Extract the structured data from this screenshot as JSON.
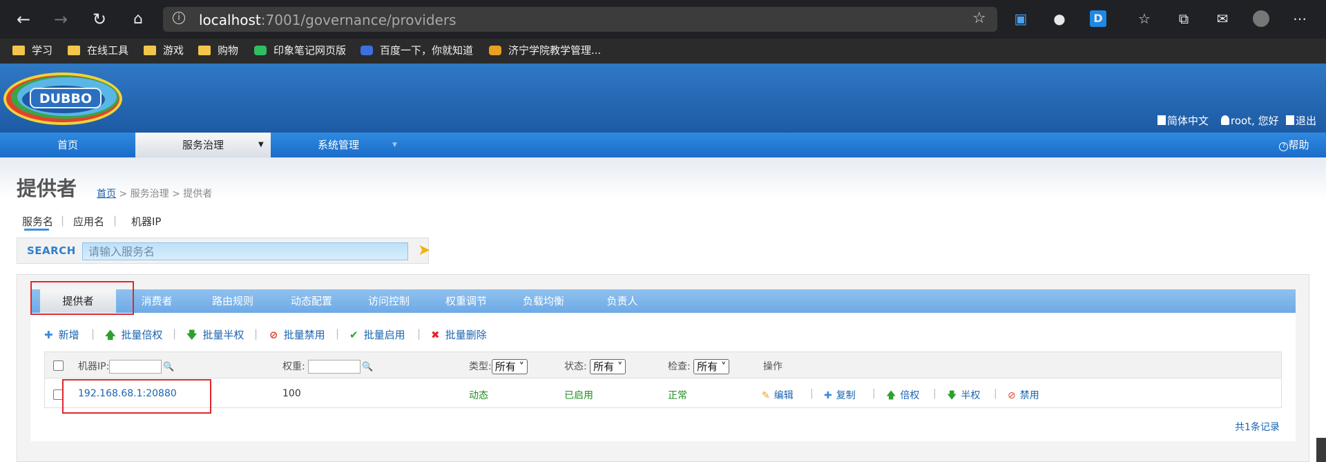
{
  "browser": {
    "url_host": "localhost",
    "url_path": ":7001/governance/providers",
    "bookmarks": [
      "学习",
      "在线工具",
      "游戏",
      "购物",
      "印象笔记网页版",
      "百度一下，你就知道",
      "济宁学院教学管理..."
    ]
  },
  "header": {
    "logo_text": "DUBBO",
    "language": "简体中文",
    "user_greeting": "root, 您好",
    "logout": "退出",
    "help": "帮助"
  },
  "nav": {
    "home": "首页",
    "governance": "服务治理",
    "system": "系统管理"
  },
  "page": {
    "title": "提供者",
    "breadcrumb_home": "首页",
    "breadcrumb_rest": " > 服务治理 > 提供者",
    "filter_tabs": [
      "服务名",
      "应用名",
      "机器IP"
    ]
  },
  "search": {
    "label": "SEARCH",
    "placeholder": "请输入服务名"
  },
  "tabs": [
    "提供者",
    "消费者",
    "路由规则",
    "动态配置",
    "访问控制",
    "权重调节",
    "负载均衡",
    "负责人"
  ],
  "actions": [
    "新增",
    "批量倍权",
    "批量半权",
    "批量禁用",
    "批量启用",
    "批量删除"
  ],
  "table": {
    "headers": {
      "ip": "机器IP:",
      "weight": "权重:",
      "type": "类型:",
      "status": "状态:",
      "check": "检查:",
      "ops": "操作"
    },
    "type_filter": "所有",
    "status_filter": "所有",
    "check_filter": "所有",
    "rows": [
      {
        "address": "192.168.68.1:20880",
        "weight": "100",
        "type": "动态",
        "status": "已启用",
        "check": "正常"
      }
    ],
    "row_ops": [
      "编辑",
      "复制",
      "倍权",
      "半权",
      "禁用"
    ],
    "total": "共1条记录"
  },
  "colors": {
    "header_blue": "#1d5aa4",
    "nav_blue": "#1a6cc8",
    "tab_blue": "#6eaae6",
    "link_blue": "#1a64b0",
    "status_green": "#1e8f1e",
    "highlight_red": "#e0262c"
  }
}
